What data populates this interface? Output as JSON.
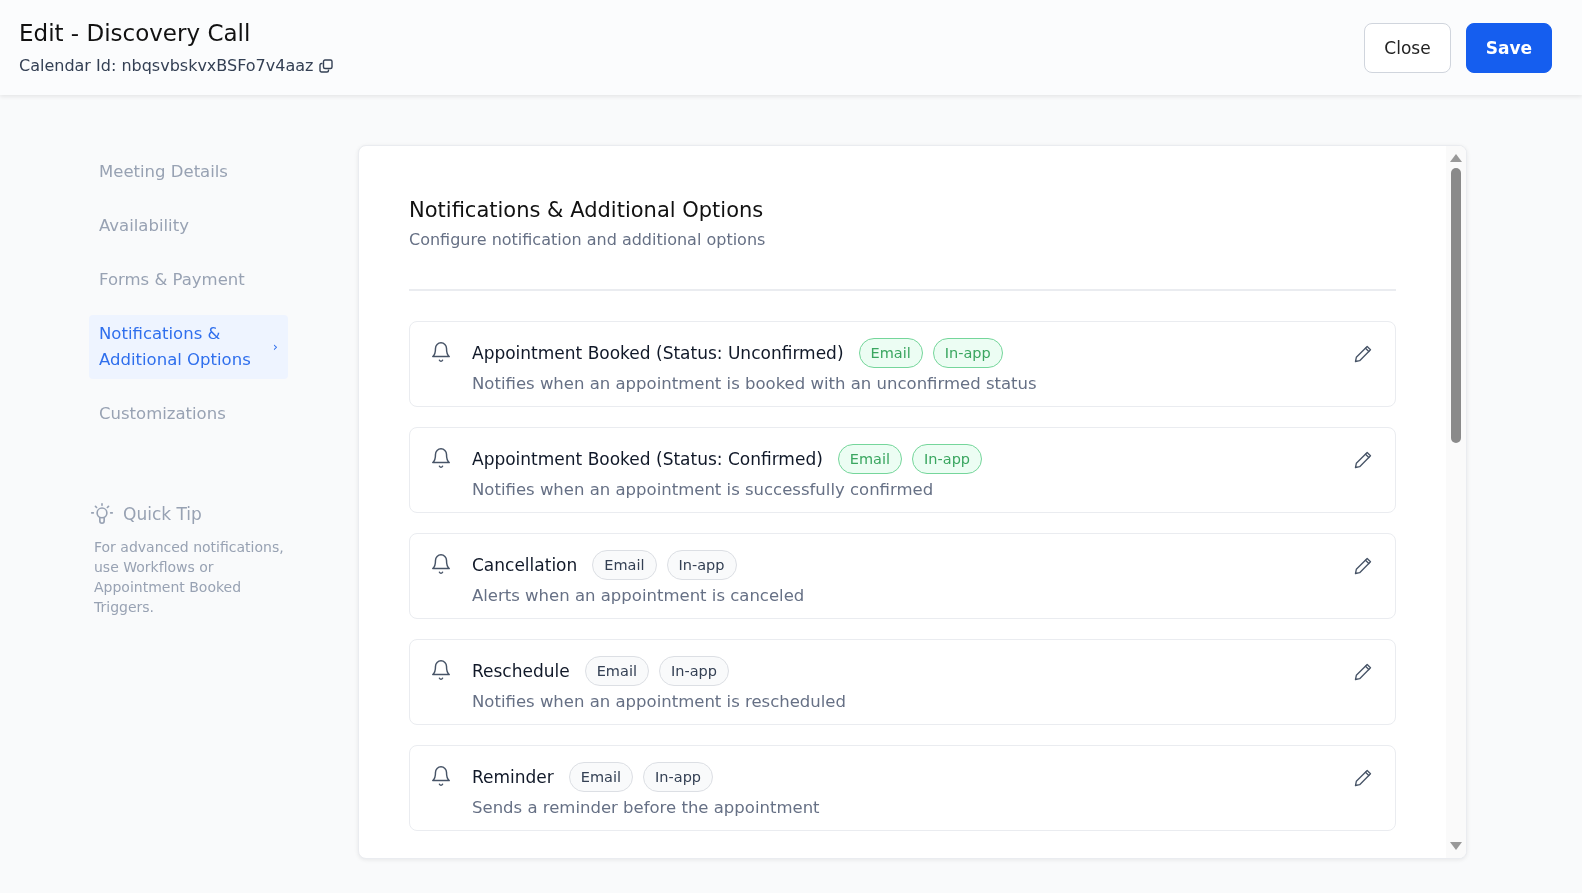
{
  "header": {
    "title": "Edit - Discovery Call",
    "calendar_id": "Calendar Id: nbqsvbskvxBSFo7v4aaz",
    "buttons": [
      {
        "label": "Close",
        "kind": "secondary"
      },
      {
        "label": "Save",
        "kind": "primary"
      }
    ]
  },
  "sidebar": {
    "items": [
      {
        "label": "Meeting Details",
        "selected": false
      },
      {
        "label": "Availability",
        "selected": false
      },
      {
        "label": "Forms & Payment",
        "selected": false
      },
      {
        "label": "Notifications & Additional Options",
        "selected": true,
        "chevron": "›"
      },
      {
        "label": "Customizations",
        "selected": false
      }
    ],
    "quick_tip": {
      "title": "Quick Tip",
      "text": "For advanced notifications, use Workflows or Appointment Booked Triggers."
    }
  },
  "panel": {
    "title": "Notifications & Additional Options",
    "subtitle": "Configure notification and additional options",
    "notifications": [
      {
        "title": "Appointment Booked (Status: Unconfirmed)",
        "description": "Notifies when an appointment is booked with an unconfirmed status",
        "channels": [
          {
            "label": "Email",
            "active": true
          },
          {
            "label": "In-app",
            "active": true
          }
        ]
      },
      {
        "title": "Appointment Booked (Status: Confirmed)",
        "description": "Notifies when an appointment is successfully confirmed",
        "channels": [
          {
            "label": "Email",
            "active": true
          },
          {
            "label": "In-app",
            "active": true
          }
        ]
      },
      {
        "title": "Cancellation",
        "description": "Alerts when an appointment is canceled",
        "channels": [
          {
            "label": "Email",
            "active": false
          },
          {
            "label": "In-app",
            "active": false
          }
        ]
      },
      {
        "title": "Reschedule",
        "description": "Notifies when an appointment is rescheduled",
        "channels": [
          {
            "label": "Email",
            "active": false
          },
          {
            "label": "In-app",
            "active": false
          }
        ]
      },
      {
        "title": "Reminder",
        "description": "Sends a reminder before the appointment",
        "channels": [
          {
            "label": "Email",
            "active": false
          },
          {
            "label": "In-app",
            "active": false
          }
        ]
      }
    ]
  }
}
